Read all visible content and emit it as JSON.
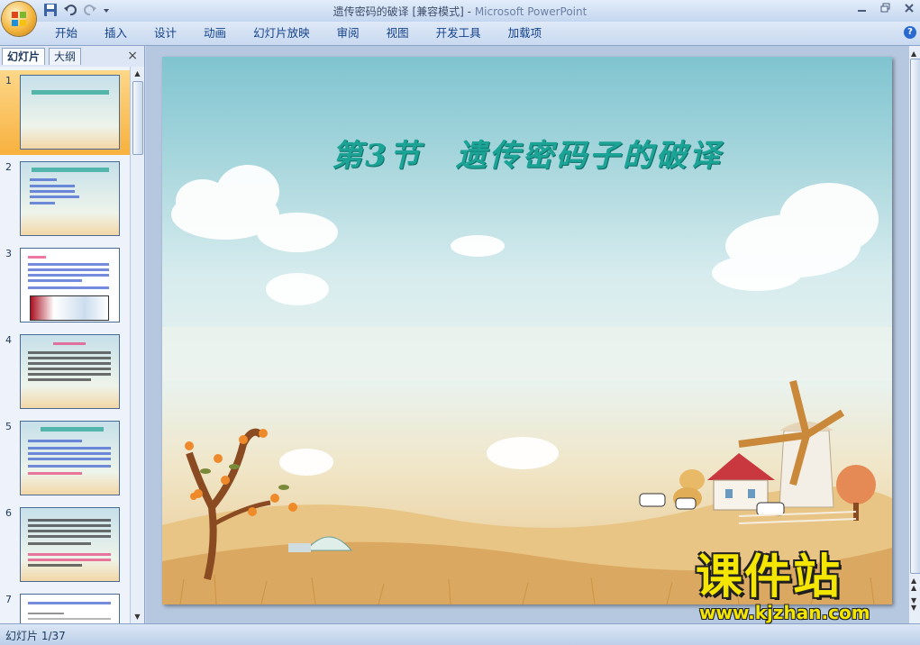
{
  "window": {
    "title": "遗传密码的破译 [兼容模式] - ",
    "app_name": "Microsoft PowerPoint"
  },
  "ribbon": {
    "tabs": [
      "开始",
      "插入",
      "设计",
      "动画",
      "幻灯片放映",
      "审阅",
      "视图",
      "开发工具",
      "加载项"
    ]
  },
  "left_pane": {
    "tab_slides": "幻灯片",
    "tab_outline": "大纲",
    "close_glyph": "×",
    "thumbnails": [
      {
        "num": "1"
      },
      {
        "num": "2"
      },
      {
        "num": "3"
      },
      {
        "num": "4"
      },
      {
        "num": "5"
      },
      {
        "num": "6"
      },
      {
        "num": "7"
      }
    ]
  },
  "slide": {
    "title": "第3节　遗传密码子的破译"
  },
  "status": {
    "slide_counter": "幻灯片 1/37"
  },
  "watermark": {
    "main": "课件站",
    "url": "www.kjzhan.com"
  },
  "colors": {
    "title_teal": "#1ba395",
    "watermark_yellow": "#f4e600",
    "selection_orange": "#f7b13e"
  },
  "icons": [
    "office-button-icon",
    "save-icon",
    "undo-icon",
    "redo-icon",
    "minimize-icon",
    "restore-icon",
    "close-icon",
    "help-icon",
    "windmill-illustration",
    "tree-illustration"
  ]
}
